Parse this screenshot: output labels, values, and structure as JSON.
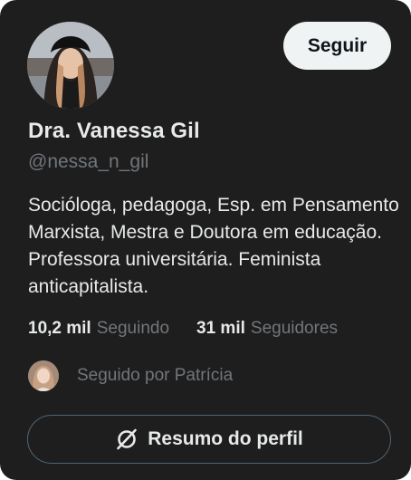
{
  "profile": {
    "name": "Dra. Vanessa Gil",
    "handle": "@nessa_n_gil",
    "bio": "Socióloga, pedagoga, Esp. em Pensamento Marxista, Mestra e Doutora em educação. Professora universitária. Feminista anticapitalista."
  },
  "actions": {
    "follow_label": "Seguir",
    "summary_label": "Resumo do perfil"
  },
  "stats": {
    "following_count": "10,2 mil",
    "following_label": "Seguindo",
    "followers_count": "31 mil",
    "followers_label": "Seguidores"
  },
  "followed_by": {
    "text": "Seguido por Patrícia"
  },
  "colors": {
    "background": "#1e1e1e",
    "text_primary": "#e7e9ea",
    "text_secondary": "#71767b",
    "follow_button_bg": "#eff3f4"
  },
  "icons": {
    "summary": "ai-summary-icon"
  }
}
